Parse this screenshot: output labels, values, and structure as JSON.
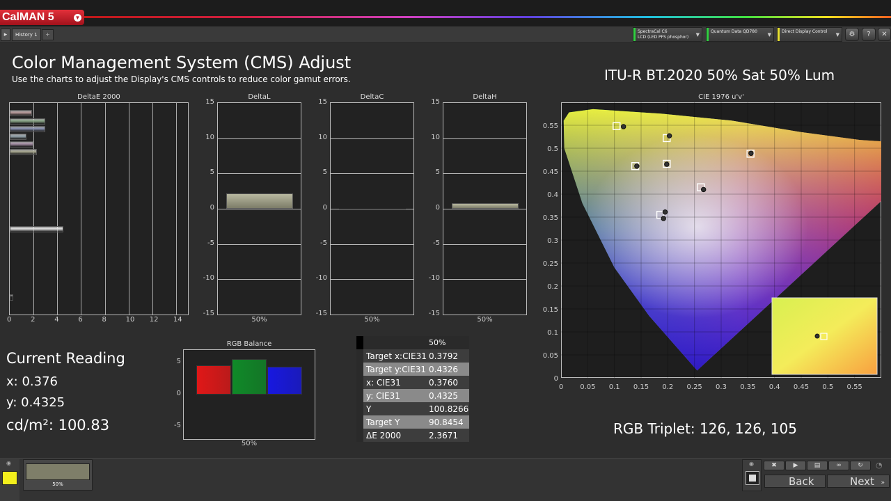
{
  "app": {
    "name": "CalMAN 5",
    "tab": "History 1",
    "tab_add": "+"
  },
  "devices": [
    {
      "line1": "SpectraCal C6",
      "line2": "LCD (LED PFS phosphor)",
      "color": "#30d040"
    },
    {
      "line1": "Quantum Data QD780",
      "line2": "",
      "color": "#30d040"
    },
    {
      "line1": "Direct Display Control",
      "line2": "",
      "color": "#e8e030"
    }
  ],
  "toolbar_icons": [
    "gear-icon",
    "help-icon",
    "close-icon"
  ],
  "page": {
    "title": "Color Management System (CMS) Adjust",
    "subtitle": "Use the charts to adjust the Display's CMS controls to reduce color gamut errors.",
    "target_label": "ITU-R BT.2020 50% Sat 50% Lum",
    "rgb_triplet": "RGB Triplet: 126, 126, 105"
  },
  "reading": {
    "heading": "Current Reading",
    "x": "x: 0.376",
    "y": "y: 0.4325",
    "lum": "cd/m²: 100.83"
  },
  "table": {
    "header": "50%",
    "rows": [
      {
        "label": "Target x:CIE31",
        "value": "0.3792"
      },
      {
        "label": "Target y:CIE31",
        "value": "0.4326"
      },
      {
        "label": "x: CIE31",
        "value": "0.3760"
      },
      {
        "label": "y: CIE31",
        "value": "0.4325"
      },
      {
        "label": "Y",
        "value": "100.8266"
      },
      {
        "label": "Target Y",
        "value": "90.8454"
      },
      {
        "label": "ΔE 2000",
        "value": "2.3671"
      }
    ]
  },
  "chart_data": [
    {
      "type": "bar",
      "title": "DeltaE 2000",
      "orientation": "horizontal",
      "xlim": [
        0,
        15
      ],
      "xticks": [
        "0",
        "2",
        "4",
        "6",
        "8",
        "10",
        "12",
        "14"
      ],
      "bars": [
        {
          "value": 1.9,
          "color": "#b89898"
        },
        {
          "value": 3.0,
          "color": "#8aa888"
        },
        {
          "value": 3.0,
          "color": "#8890b0"
        },
        {
          "value": 1.4,
          "color": "#98a8b0"
        },
        {
          "value": 2.0,
          "color": "#a890a8"
        },
        {
          "value": 2.3,
          "color": "#a8a890"
        },
        {
          "value": 4.5,
          "color": "#e0e0e0"
        },
        {
          "value": 0.3,
          "color": "#202020"
        }
      ]
    },
    {
      "type": "bar",
      "title": "DeltaL",
      "categories": [
        "50%"
      ],
      "values": [
        2.2
      ],
      "ylim": [
        -15,
        15
      ],
      "yticks": [
        "15",
        "10",
        "5",
        "0",
        "-5",
        "-10",
        "-15"
      ]
    },
    {
      "type": "bar",
      "title": "DeltaC",
      "categories": [
        "50%"
      ],
      "values": [
        -0.1
      ],
      "ylim": [
        -15,
        15
      ],
      "yticks": [
        "15",
        "10",
        "5",
        "0",
        "-5",
        "-10",
        "-15"
      ]
    },
    {
      "type": "bar",
      "title": "DeltaH",
      "categories": [
        "50%"
      ],
      "values": [
        0.8
      ],
      "ylim": [
        -15,
        15
      ],
      "yticks": [
        "15",
        "10",
        "5",
        "0",
        "-5",
        "-10",
        "-15"
      ]
    },
    {
      "type": "bar",
      "title": "RGB Balance",
      "categories": [
        "50%"
      ],
      "series": [
        {
          "name": "R",
          "value": 4.6,
          "color": "#e01818"
        },
        {
          "name": "G",
          "value": 5.6,
          "color": "#108a28"
        },
        {
          "name": "B",
          "value": 4.4,
          "color": "#1818e0"
        }
      ],
      "ylim": [
        -7,
        7
      ],
      "yticks": [
        "5",
        "0",
        "-5"
      ]
    },
    {
      "type": "scatter",
      "title": "CIE 1976 u'v'",
      "xlim": [
        0,
        0.6
      ],
      "ylim": [
        0,
        0.6
      ],
      "xticks": [
        "0",
        "0.05",
        "0.1",
        "0.15",
        "0.2",
        "0.25",
        "0.3",
        "0.35",
        "0.4",
        "0.45",
        "0.5",
        "0.55"
      ],
      "yticks": [
        "0.55",
        "0.5",
        "0.45",
        "0.4",
        "0.35",
        "0.3",
        "0.25",
        "0.2",
        "0.15",
        "0.1",
        "0.05",
        "0"
      ],
      "targets": [
        [
          0.104,
          0.548
        ],
        [
          0.198,
          0.522
        ],
        [
          0.355,
          0.488
        ],
        [
          0.139,
          0.461
        ],
        [
          0.198,
          0.466
        ],
        [
          0.262,
          0.415
        ],
        [
          0.186,
          0.355
        ]
      ],
      "measured": [
        [
          0.117,
          0.547
        ],
        [
          0.203,
          0.527
        ],
        [
          0.356,
          0.489
        ],
        [
          0.142,
          0.461
        ],
        [
          0.198,
          0.465
        ],
        [
          0.267,
          0.41
        ],
        [
          0.195,
          0.361
        ],
        [
          0.192,
          0.347
        ]
      ]
    }
  ],
  "bottom": {
    "swatch_label": "50%",
    "back": "Back",
    "next": "Next",
    "ctl_icons": [
      "delete-icon",
      "play-icon",
      "erase-icon",
      "loop-icon",
      "refresh-icon"
    ]
  }
}
